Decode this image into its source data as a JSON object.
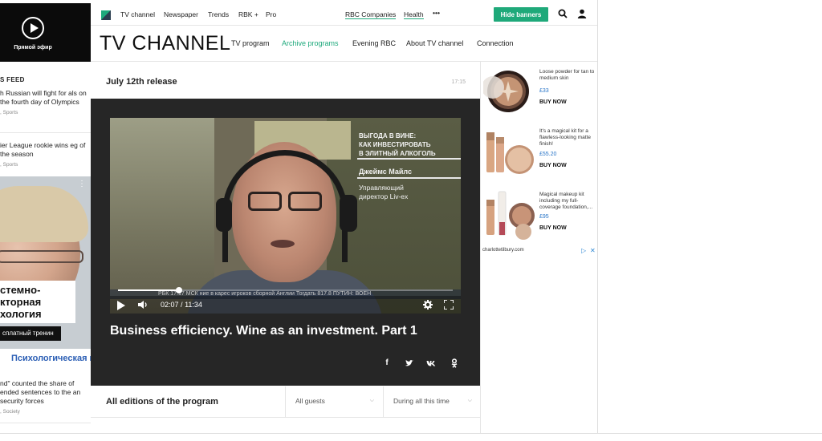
{
  "live": {
    "label": "Прямой эфир"
  },
  "feed": {
    "title": "S FEED",
    "items": [
      {
        "text": "h Russian will fight for als on the fourth day of Olympics",
        "meta": ", Sports"
      },
      {
        "text": "ier League rookie wins eg of the season",
        "meta": ", Sports"
      },
      {
        "text": "nd\" counted the share of ended sentences to the an security forces",
        "meta": ", Society"
      }
    ]
  },
  "left_ad": {
    "headline": "стемно- кторная хология",
    "button": "сплатный тренин",
    "strip": "Психологическая в"
  },
  "topbar": {
    "items": [
      "TV channel",
      "Newspaper",
      "Trends",
      "RBK +",
      "Pro"
    ],
    "rbc_companies": "RBC Companies",
    "health": "Health",
    "more": "•••",
    "hide_banners": "Hide banners"
  },
  "header": {
    "brand": "TV CHANNEL",
    "nav": [
      "TV program",
      "Archive programs",
      "Evening RBC",
      "About TV channel",
      "Connection"
    ]
  },
  "release": {
    "title": "July 12th release",
    "time": "17:15"
  },
  "video": {
    "caption_lines": [
      "ВЫГОДА В ВИНЕ:",
      "КАК ИНВЕСТИРОВАТЬ",
      "В ЭЛИТНЫЙ АЛКОГОЛЬ"
    ],
    "name_line": "Джеймс Майлс",
    "role_lines": [
      "Управляющий",
      "директор Liv-ex"
    ],
    "ticker": "РБК   17:17 МСК  ние в карес игроков сборной Англии        Тогдать  817.8   ПУТИН: ВОЕН",
    "current_time": "02:07",
    "separator": "/",
    "duration": "11:34",
    "progress": 0.183,
    "title": "Business efficiency. Wine as an investment. Part 1"
  },
  "share_icons": [
    "f",
    "t",
    "vk",
    "ok"
  ],
  "editions": {
    "title": "All editions of the program",
    "guest_select": "All guests",
    "period_select": "During all this time"
  },
  "ads": [
    {
      "desc": "Loose powder for tan to medium skin",
      "price": "£33",
      "cta": "BUY NOW"
    },
    {
      "desc": "It's a magical kit for a flawless-looking matte finish!",
      "price": "£55.20",
      "cta": "BUY NOW"
    },
    {
      "desc": "Magical makeup kit including my full-coverage foundation,...",
      "price": "£95",
      "cta": "BUY NOW"
    }
  ],
  "ad_domain": "charlottetilbury.com",
  "colors": {
    "accent": "#1fa97a",
    "dark_panel": "#262626",
    "link": "#2673c7"
  }
}
